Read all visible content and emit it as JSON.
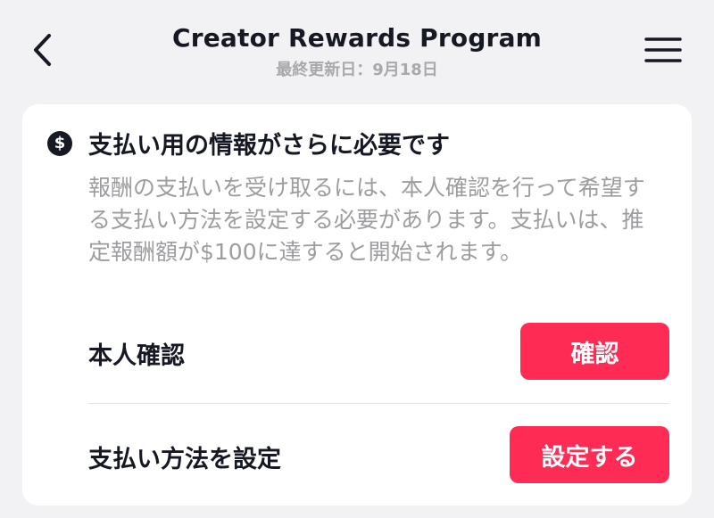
{
  "header": {
    "title": "Creator Rewards Program",
    "subtitle": "最終更新日：9月18日",
    "back_icon": "chevron-left-icon",
    "menu_icon": "hamburger-menu-icon"
  },
  "card": {
    "icon": "dollar-sign-icon",
    "icon_glyph": "$",
    "title": "支払い用の情報がさらに必要です",
    "description": "報酬の支払いを受け取るには、本人確認を行って希望する支払い方法を設定する必要があります。支払いは、推定報酬額が$100に達すると開始されます。",
    "rows": [
      {
        "label": "本人確認",
        "button": "確認"
      },
      {
        "label": "支払い方法を設定",
        "button": "設定する"
      }
    ]
  },
  "colors": {
    "accent": "#fe2c55",
    "text_primary": "#161823",
    "text_secondary": "#9d9da1",
    "background": "#f2f2f4",
    "card": "#ffffff"
  }
}
